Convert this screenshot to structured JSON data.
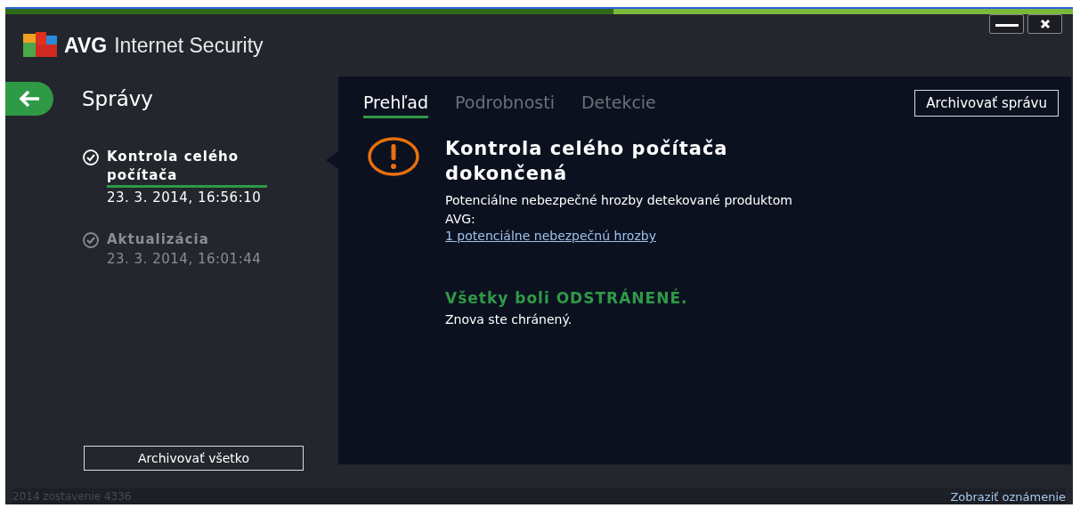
{
  "window": {
    "brand": "AVG",
    "product": "Internet Security"
  },
  "sidebar": {
    "title": "Správy",
    "reports": [
      {
        "name": "Kontrola celého počítača",
        "date": "23. 3. 2014, 16:56:10",
        "selected": true
      },
      {
        "name": "Aktualizácia",
        "date": "23. 3. 2014, 16:01:44",
        "selected": false
      }
    ],
    "archive_all_button": "Archivovať všetko"
  },
  "tabs": [
    {
      "label": "Prehľad",
      "selected": true
    },
    {
      "label": "Podrobnosti",
      "selected": false
    },
    {
      "label": "Detekcie",
      "selected": false
    }
  ],
  "archive_report_button": "Archivovať správu",
  "result": {
    "title": "Kontrola celého počítača dokončená",
    "description": "Potenciálne nebezpečné hrozby detekované produktom AVG:",
    "threats_link": "1 potenciálne nebezpečnú hrozby",
    "status": "Všetky boli ODSTRÁNENÉ.",
    "note": "Znova ste chránený."
  },
  "status_bar": {
    "build": "2014  zostavenie 4336",
    "notifications_link": "Zobraziť oznámenie"
  }
}
